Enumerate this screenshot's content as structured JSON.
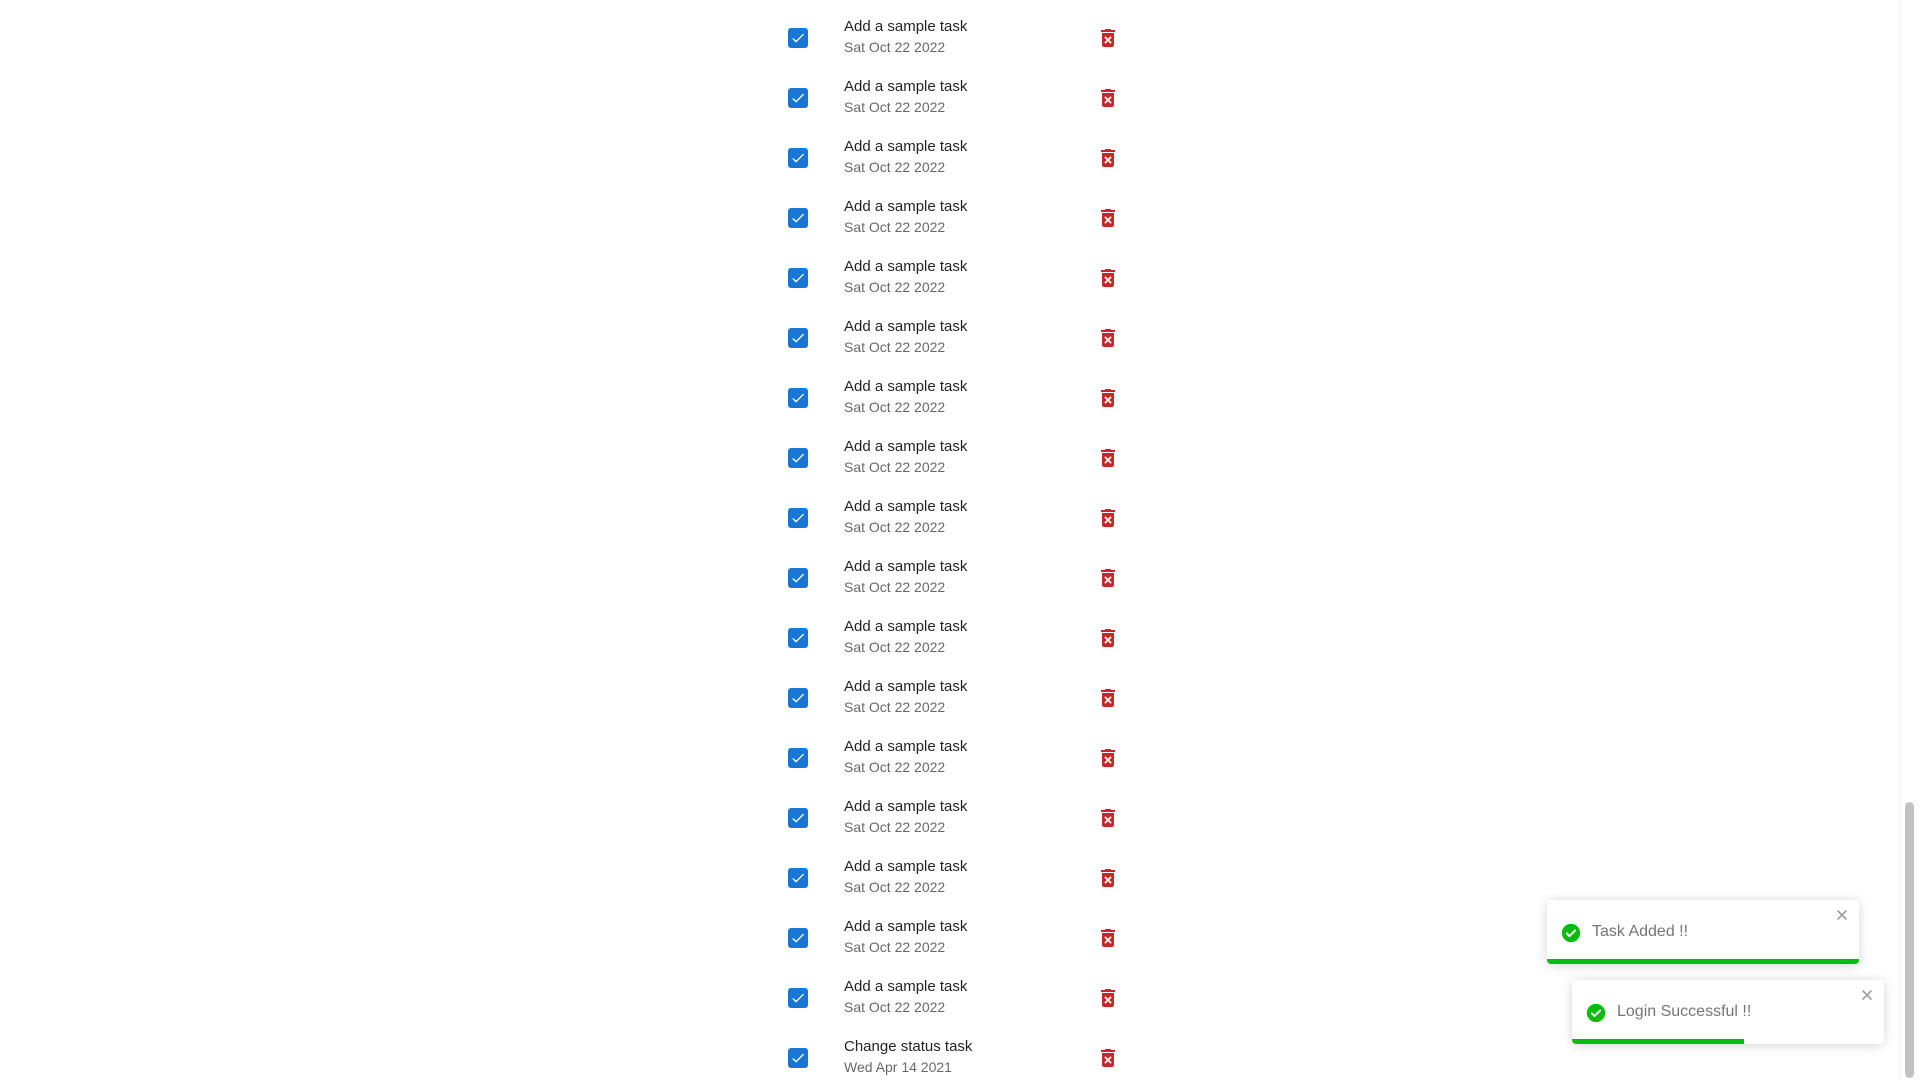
{
  "colors": {
    "checkbox": "#1976d2",
    "delete_icon": "#c62828",
    "toast_success": "#07bc0c",
    "scrollbar_thumb": "#c1c1c1"
  },
  "tasks": [
    {
      "title": "Add a sample task",
      "date": "Sat Oct 22 2022",
      "checked": true
    },
    {
      "title": "Add a sample task",
      "date": "Sat Oct 22 2022",
      "checked": true
    },
    {
      "title": "Add a sample task",
      "date": "Sat Oct 22 2022",
      "checked": true
    },
    {
      "title": "Add a sample task",
      "date": "Sat Oct 22 2022",
      "checked": true
    },
    {
      "title": "Add a sample task",
      "date": "Sat Oct 22 2022",
      "checked": true
    },
    {
      "title": "Add a sample task",
      "date": "Sat Oct 22 2022",
      "checked": true
    },
    {
      "title": "Add a sample task",
      "date": "Sat Oct 22 2022",
      "checked": true
    },
    {
      "title": "Add a sample task",
      "date": "Sat Oct 22 2022",
      "checked": true
    },
    {
      "title": "Add a sample task",
      "date": "Sat Oct 22 2022",
      "checked": true
    },
    {
      "title": "Add a sample task",
      "date": "Sat Oct 22 2022",
      "checked": true
    },
    {
      "title": "Add a sample task",
      "date": "Sat Oct 22 2022",
      "checked": true
    },
    {
      "title": "Add a sample task",
      "date": "Sat Oct 22 2022",
      "checked": true
    },
    {
      "title": "Add a sample task",
      "date": "Sat Oct 22 2022",
      "checked": true
    },
    {
      "title": "Add a sample task",
      "date": "Sat Oct 22 2022",
      "checked": true
    },
    {
      "title": "Add a sample task",
      "date": "Sat Oct 22 2022",
      "checked": true
    },
    {
      "title": "Add a sample task",
      "date": "Sat Oct 22 2022",
      "checked": true
    },
    {
      "title": "Add a sample task",
      "date": "Sat Oct 22 2022",
      "checked": true
    },
    {
      "title": "Change status task",
      "date": "Wed Apr 14 2021",
      "checked": true
    }
  ],
  "toasts": [
    {
      "message": "Task Added !!",
      "type": "success",
      "progress": 1.0
    },
    {
      "message": "Login Successful !!",
      "type": "success",
      "progress": 0.55
    }
  ],
  "scrollbar": {
    "scroll_fraction": 1.0
  },
  "icons": {
    "checkbox": "checkbox-checked-icon",
    "delete": "delete-forever-icon",
    "toast_status": "check-circle-icon",
    "toast_close": "close-icon"
  }
}
